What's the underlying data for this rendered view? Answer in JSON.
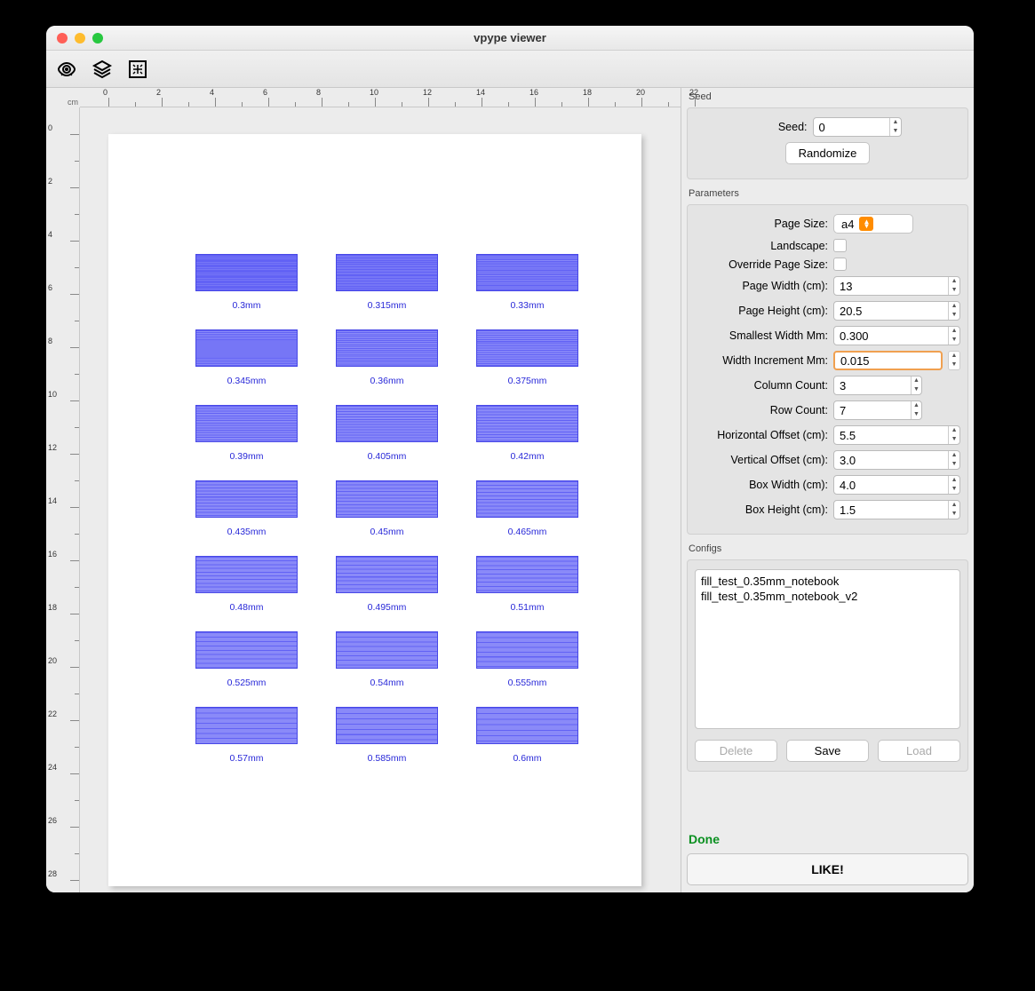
{
  "window_title": "vpype viewer",
  "ruler_unit": "cm",
  "ruler_start": 0,
  "ruler_end": 20,
  "ruler_v_end": 30,
  "seed": {
    "label": "Seed:",
    "value": "0",
    "randomize_label": "Randomize",
    "section": "Seed"
  },
  "parameters": {
    "section": "Parameters",
    "page_size": {
      "label": "Page Size:",
      "value": "a4"
    },
    "landscape": {
      "label": "Landscape:"
    },
    "override_page_size": {
      "label": "Override Page Size:"
    },
    "page_width": {
      "label": "Page Width (cm):",
      "value": "13"
    },
    "page_height": {
      "label": "Page Height (cm):",
      "value": "20.5"
    },
    "smallest_width": {
      "label": "Smallest Width Mm:",
      "value": "0.300"
    },
    "width_increment": {
      "label": "Width Increment Mm:",
      "value": "0.015"
    },
    "column_count": {
      "label": "Column Count:",
      "value": "3"
    },
    "row_count": {
      "label": "Row Count:",
      "value": "7"
    },
    "horizontal_offset": {
      "label": "Horizontal Offset (cm):",
      "value": "5.5"
    },
    "vertical_offset": {
      "label": "Vertical Offset (cm):",
      "value": "3.0"
    },
    "box_width": {
      "label": "Box Width (cm):",
      "value": "4.0"
    },
    "box_height": {
      "label": "Box Height (cm):",
      "value": "1.5"
    }
  },
  "configs": {
    "section": "Configs",
    "items": [
      "fill_test_0.35mm_notebook",
      "fill_test_0.35mm_notebook_v2"
    ],
    "delete_label": "Delete",
    "save_label": "Save",
    "load_label": "Load"
  },
  "status_text": "Done",
  "like_label": "LIKE!",
  "boxes": [
    {
      "label": "0.3mm"
    },
    {
      "label": "0.315mm"
    },
    {
      "label": "0.33mm"
    },
    {
      "label": "0.345mm"
    },
    {
      "label": "0.36mm"
    },
    {
      "label": "0.375mm"
    },
    {
      "label": "0.39mm"
    },
    {
      "label": "0.405mm"
    },
    {
      "label": "0.42mm"
    },
    {
      "label": "0.435mm"
    },
    {
      "label": "0.45mm"
    },
    {
      "label": "0.465mm"
    },
    {
      "label": "0.48mm"
    },
    {
      "label": "0.495mm"
    },
    {
      "label": "0.51mm"
    },
    {
      "label": "0.525mm"
    },
    {
      "label": "0.54mm"
    },
    {
      "label": "0.555mm"
    },
    {
      "label": "0.57mm"
    },
    {
      "label": "0.585mm"
    },
    {
      "label": "0.6mm"
    }
  ]
}
